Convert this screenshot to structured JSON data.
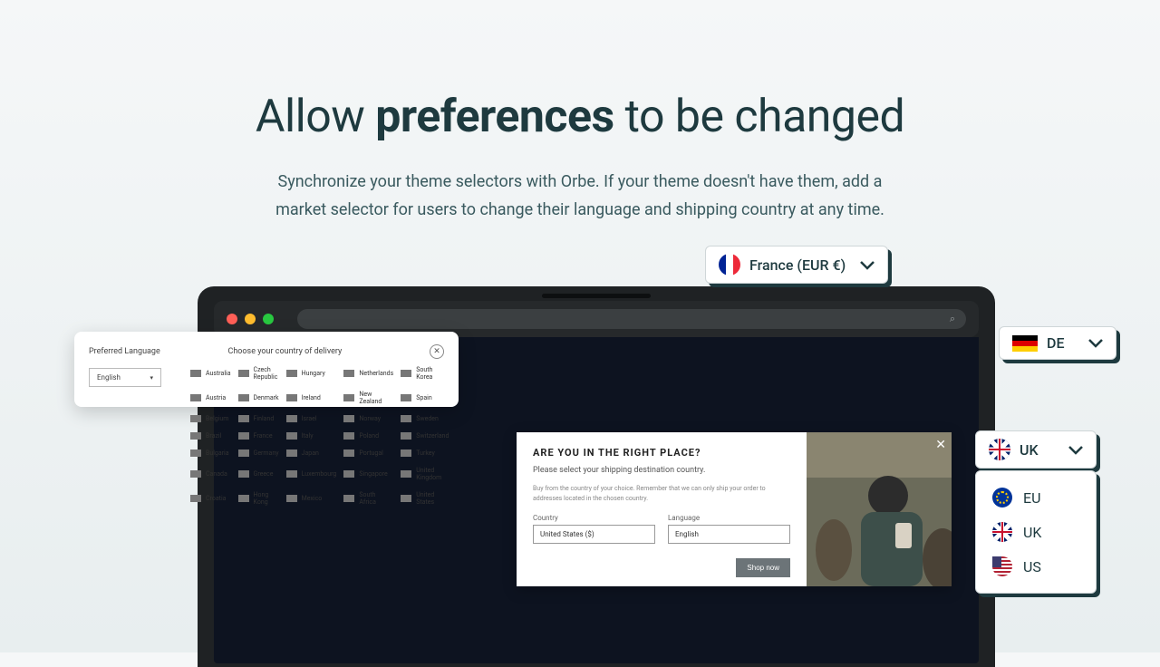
{
  "hero": {
    "title_pre": "Allow ",
    "title_bold": "preferences",
    "title_post": " to be changed",
    "subtitle": "Synchronize your theme selectors with Orbe. If your theme doesn't have them, add a market selector for users to change their language and shipping country at any time."
  },
  "selectors": {
    "france": "France (EUR €)",
    "de": "DE",
    "uk": "UK",
    "options": [
      {
        "code": "EU",
        "label": "EU"
      },
      {
        "code": "UK",
        "label": "UK"
      },
      {
        "code": "US",
        "label": "US"
      }
    ]
  },
  "lang_card": {
    "title_left": "Preferred Language",
    "title_center": "Choose your country of delivery",
    "select_value": "English",
    "countries": [
      "Australia",
      "Czech Republic",
      "Hungary",
      "Netherlands",
      "South Korea",
      "Austria",
      "Denmark",
      "Ireland",
      "New Zealand",
      "Spain",
      "Belgium",
      "Finland",
      "Israel",
      "Norway",
      "Sweden",
      "Brazil",
      "France",
      "Italy",
      "Poland",
      "Switzerland",
      "Bulgaria",
      "Germany",
      "Japan",
      "Portugal",
      "Turkey",
      "Canada",
      "Greece",
      "Luxembourg",
      "Singapore",
      "United Kingdom",
      "Croatia",
      "Hong Kong",
      "Mexico",
      "South Africa",
      "United States"
    ]
  },
  "right_place": {
    "heading": "ARE YOU IN THE RIGHT PLACE?",
    "subtitle": "Please select your shipping destination country.",
    "fine": "Buy from the country of your choice. Remember that we can only ship your order to addresses located in the chosen country.",
    "country_label": "Country",
    "country_value": "United States ($)",
    "language_label": "Language",
    "language_value": "English",
    "button": "Shop now"
  }
}
